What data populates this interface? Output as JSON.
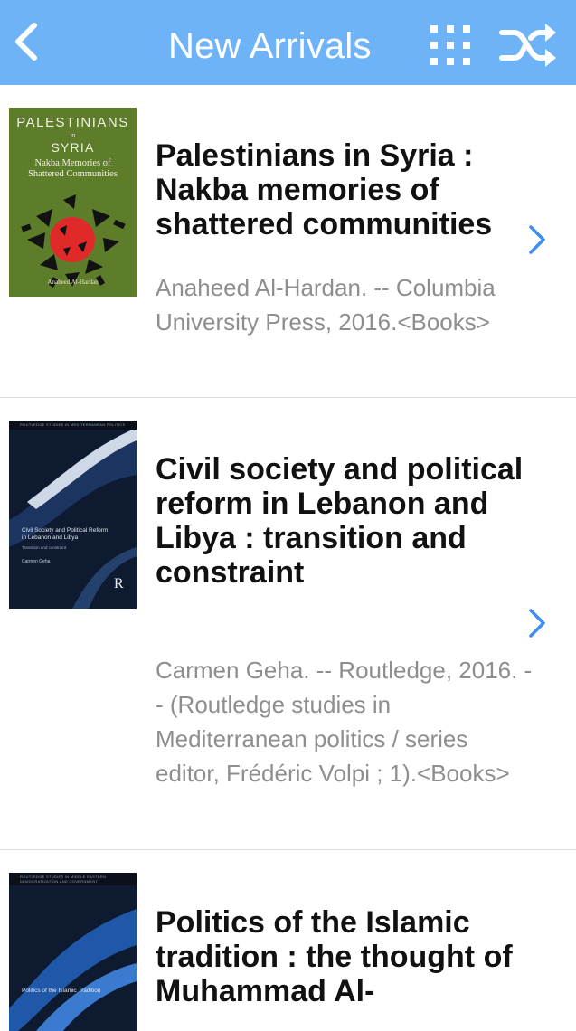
{
  "header": {
    "title": "New Arrivals",
    "background": "#6eb3f7",
    "back_icon": "chevron-left-icon",
    "grid_icon": "grid-icon",
    "shuffle_icon": "shuffle-icon"
  },
  "items": [
    {
      "title": "Palestinians in Syria : Nakba memories of shattered communities",
      "meta": "Anaheed Al-Hardan. -- Columbia University Press, 2016.<Books>",
      "cover": {
        "line1": "PALESTINIANS",
        "line2": "in",
        "line3": "SYRIA",
        "line4": "Nakba Memories of Shattered Communities",
        "author": "Anaheed Al-Hardan"
      }
    },
    {
      "title": "Civil society and political reform in Lebanon and Libya : transition and constraint",
      "meta": "Carmen Geha. -- Routledge, 2016. -- (Routledge studies in Mediterranean politics / series editor, Frédéric Volpi ; 1).<Books>",
      "cover": {
        "series": "ROUTLEDGE STUDIES IN MEDITERRANEAN POLITICS",
        "title": "Civil Society and Political Reform in Lebanon and Libya",
        "subtitle": "Transition and constraint",
        "author": "Carmen Geha",
        "logo": "R"
      }
    },
    {
      "title": "Politics of the Islamic tradition : the thought of Muhammad Al-",
      "cover": {
        "series": "ROUTLEDGE STUDIES IN MIDDLE EASTERN DEMOCRATIZATION AND GOVERNMENT",
        "title": "Politics of the Islamic Tradition"
      }
    }
  ],
  "colors": {
    "accent": "#3d8ef0",
    "title_text": "#111111",
    "meta_text": "#8e8e8e",
    "divider": "#dcdcdc"
  }
}
